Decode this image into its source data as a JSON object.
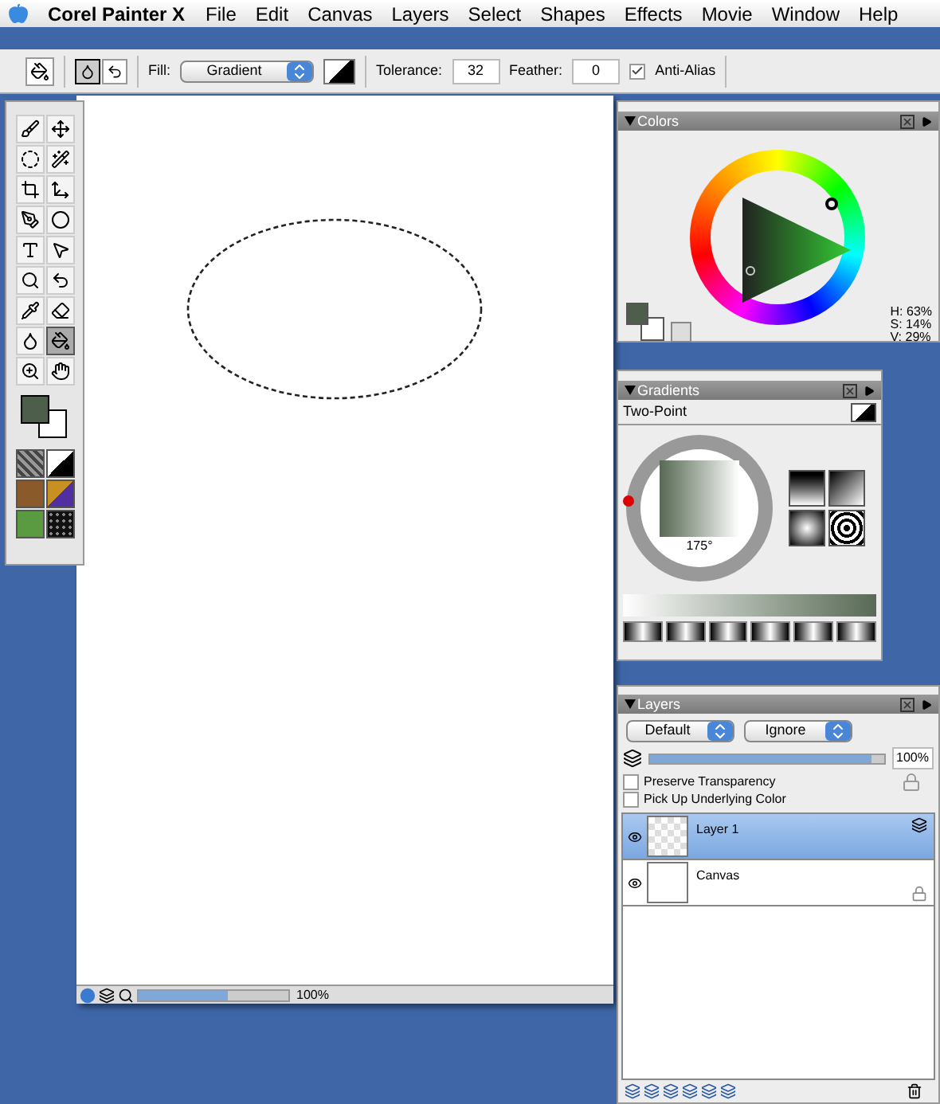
{
  "menu_bar": {
    "app_name": "Corel Painter X",
    "items": [
      "File",
      "Edit",
      "Canvas",
      "Layers",
      "Select",
      "Shapes",
      "Effects",
      "Movie",
      "Window",
      "Help"
    ]
  },
  "property_bar": {
    "fill_label": "Fill:",
    "fill_value": "Gradient",
    "tolerance_label": "Tolerance:",
    "tolerance": "32",
    "feather_label": "Feather:",
    "feather": "0",
    "anti_alias": {
      "label": "Anti-Alias",
      "checked": true
    }
  },
  "toolbox": {
    "tools": [
      {
        "selected": false
      },
      {
        "selected": false
      },
      {
        "selected": false
      },
      {
        "selected": false
      },
      {
        "selected": false
      },
      {
        "selected": false
      },
      {
        "selected": false
      },
      {
        "selected": false
      },
      {
        "selected": false
      },
      {
        "selected": false
      },
      {
        "selected": false
      },
      {
        "selected": false
      },
      {
        "selected": false
      },
      {
        "selected": false
      },
      {
        "selected": false
      },
      {
        "selected": true
      },
      {
        "selected": false
      },
      {
        "selected": false
      }
    ]
  },
  "document": {
    "zoom_slider": {
      "level": 0.6
    },
    "zoom": "100%"
  },
  "colors_panel": {
    "title": "Colors",
    "readouts": [
      "H: 63%",
      "S: 14%",
      "V: 29%"
    ]
  },
  "gradients_panel": {
    "title": "Gradients",
    "type": "Two-Point",
    "angle": "175°"
  },
  "layers_panel": {
    "title": "Layers",
    "composite_method": "Default",
    "composite_depth": "Ignore",
    "opacity": {
      "level": 0.95
    },
    "opacity_value": "100%",
    "options": [
      {
        "label": "Preserve Transparency",
        "checked": false
      },
      {
        "label": "Pick Up Underlying Color",
        "checked": false
      }
    ],
    "layers": [
      {
        "name": "Layer 1",
        "kind": "transparent",
        "selected": true
      },
      {
        "name": "Canvas",
        "kind": "canvas",
        "selected": false
      }
    ]
  }
}
